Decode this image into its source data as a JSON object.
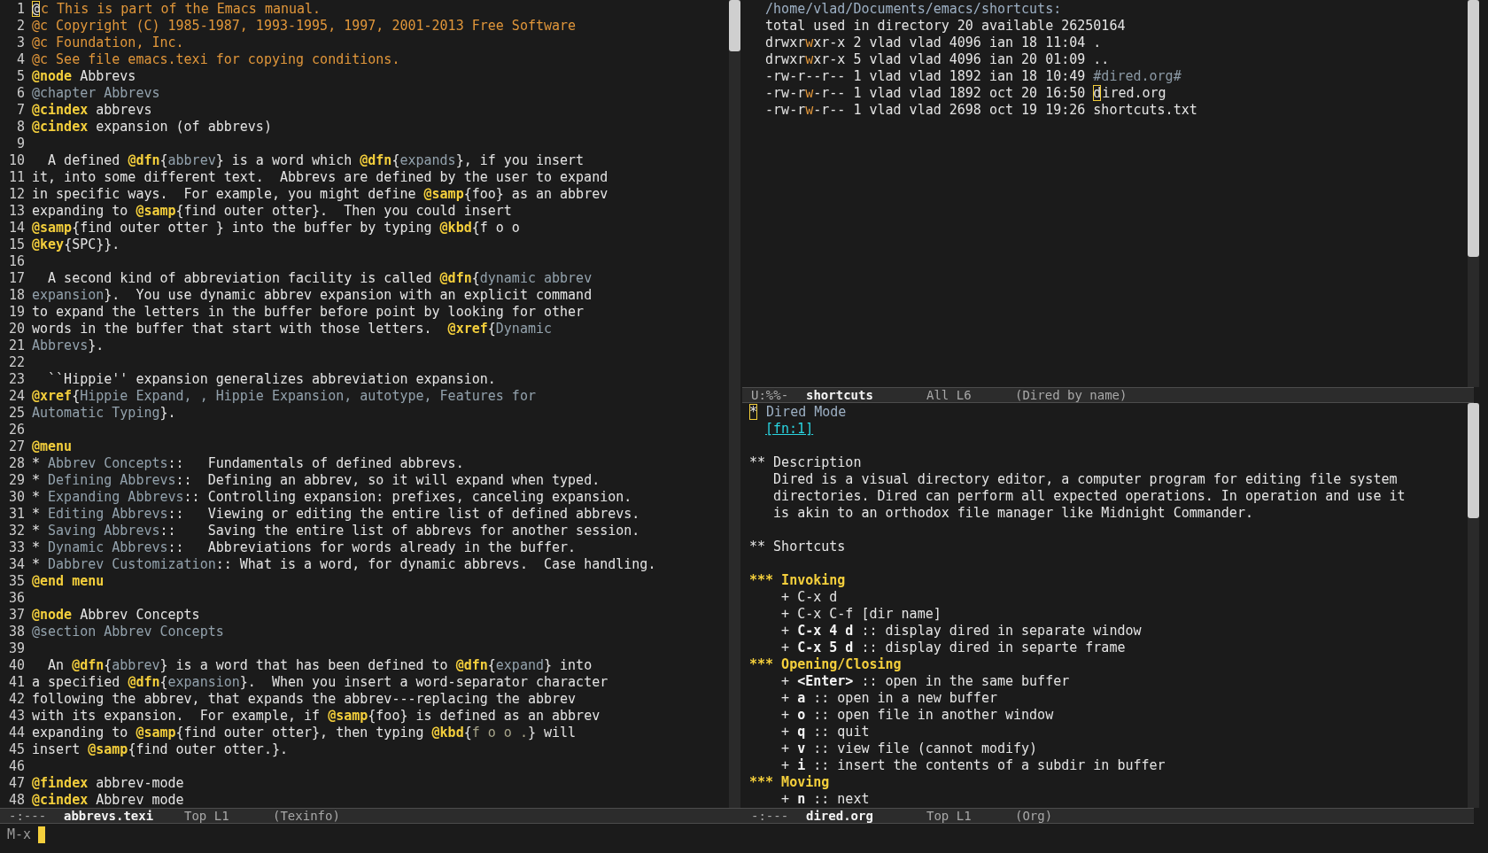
{
  "left_window": {
    "lines": [
      {
        "number": "1",
        "segments": [
          {
            "kind": "cursor",
            "text": "@"
          },
          {
            "kind": "comment",
            "text": "c This is part of the Emacs manual."
          }
        ]
      },
      {
        "number": "2",
        "segments": [
          {
            "kind": "comment",
            "text": "@c Copyright (C) 1985-1987, 1993-1995, 1997, 2001-2013 Free Software"
          }
        ]
      },
      {
        "number": "3",
        "segments": [
          {
            "kind": "comment",
            "text": "@c Foundation, Inc."
          }
        ]
      },
      {
        "number": "4",
        "segments": [
          {
            "kind": "comment",
            "text": "@c See file emacs.texi for copying conditions."
          }
        ]
      },
      {
        "number": "5",
        "segments": [
          {
            "kind": "keyword",
            "text": "@node"
          },
          {
            "kind": "plain",
            "text": " Abbrevs"
          }
        ]
      },
      {
        "number": "6",
        "segments": [
          {
            "kind": "arg",
            "text": "@chapter Abbrevs"
          }
        ]
      },
      {
        "number": "7",
        "segments": [
          {
            "kind": "keyword",
            "text": "@cindex"
          },
          {
            "kind": "plain",
            "text": " abbrevs"
          }
        ]
      },
      {
        "number": "8",
        "segments": [
          {
            "kind": "keyword",
            "text": "@cindex"
          },
          {
            "kind": "plain",
            "text": " expansion (of abbrevs)"
          }
        ]
      },
      {
        "number": "9"
      },
      {
        "number": "10",
        "segments": [
          {
            "kind": "plain",
            "text": "  A defined "
          },
          {
            "kind": "keyword",
            "text": "@dfn"
          },
          {
            "kind": "plain",
            "text": "{"
          },
          {
            "kind": "arg",
            "text": "abbrev"
          },
          {
            "kind": "plain",
            "text": "} is a word which "
          },
          {
            "kind": "keyword",
            "text": "@dfn"
          },
          {
            "kind": "plain",
            "text": "{"
          },
          {
            "kind": "arg",
            "text": "expands"
          },
          {
            "kind": "plain",
            "text": "}, if you insert"
          }
        ]
      },
      {
        "number": "11",
        "segments": [
          {
            "kind": "plain",
            "text": "it, into some different text.  Abbrevs are defined by the user to expand"
          }
        ]
      },
      {
        "number": "12",
        "segments": [
          {
            "kind": "plain",
            "text": "in specific ways.  For example, you might define "
          },
          {
            "kind": "keyword",
            "text": "@samp"
          },
          {
            "kind": "plain",
            "text": "{foo} as an abbrev"
          }
        ]
      },
      {
        "number": "13",
        "segments": [
          {
            "kind": "plain",
            "text": "expanding to "
          },
          {
            "kind": "keyword",
            "text": "@samp"
          },
          {
            "kind": "plain",
            "text": "{find outer otter}.  Then you could insert"
          }
        ]
      },
      {
        "number": "14",
        "segments": [
          {
            "kind": "keyword",
            "text": "@samp"
          },
          {
            "kind": "plain",
            "text": "{find outer otter } into the buffer by typing "
          },
          {
            "kind": "keyword",
            "text": "@kbd"
          },
          {
            "kind": "plain",
            "text": "{f o o"
          }
        ]
      },
      {
        "number": "15",
        "segments": [
          {
            "kind": "keyword",
            "text": "@key"
          },
          {
            "kind": "plain",
            "text": "{SPC}}."
          }
        ]
      },
      {
        "number": "16"
      },
      {
        "number": "17",
        "segments": [
          {
            "kind": "plain",
            "text": "  A second kind of abbreviation facility is called "
          },
          {
            "kind": "keyword",
            "text": "@dfn"
          },
          {
            "kind": "plain",
            "text": "{"
          },
          {
            "kind": "arg",
            "text": "dynamic abbrev"
          }
        ]
      },
      {
        "number": "18",
        "segments": [
          {
            "kind": "arg",
            "text": "expansion"
          },
          {
            "kind": "plain",
            "text": "}.  You use dynamic abbrev expansion with an explicit command"
          }
        ]
      },
      {
        "number": "19",
        "segments": [
          {
            "kind": "plain",
            "text": "to expand the letters in the buffer before point by looking for other"
          }
        ]
      },
      {
        "number": "20",
        "segments": [
          {
            "kind": "plain",
            "text": "words in the buffer that start with those letters.  "
          },
          {
            "kind": "keyword",
            "text": "@xref"
          },
          {
            "kind": "plain",
            "text": "{"
          },
          {
            "kind": "arg",
            "text": "Dynamic"
          }
        ]
      },
      {
        "number": "21",
        "segments": [
          {
            "kind": "arg",
            "text": "Abbrevs"
          },
          {
            "kind": "plain",
            "text": "}."
          }
        ]
      },
      {
        "number": "22"
      },
      {
        "number": "23",
        "segments": [
          {
            "kind": "plain",
            "text": "  ``Hippie'' expansion generalizes abbreviation expansion."
          }
        ]
      },
      {
        "number": "24",
        "segments": [
          {
            "kind": "keyword",
            "text": "@xref"
          },
          {
            "kind": "plain",
            "text": "{"
          },
          {
            "kind": "arg",
            "text": "Hippie Expand, , Hippie Expansion, autotype, Features for"
          }
        ]
      },
      {
        "number": "25",
        "segments": [
          {
            "kind": "arg",
            "text": "Automatic Typing"
          },
          {
            "kind": "plain",
            "text": "}."
          }
        ]
      },
      {
        "number": "26"
      },
      {
        "number": "27",
        "segments": [
          {
            "kind": "keyword",
            "text": "@menu"
          }
        ]
      },
      {
        "number": "28",
        "segments": [
          {
            "kind": "plain",
            "text": "* "
          },
          {
            "kind": "arg",
            "text": "Abbrev Concepts"
          },
          {
            "kind": "plain",
            "text": "::   Fundamentals of defined abbrevs."
          }
        ]
      },
      {
        "number": "29",
        "segments": [
          {
            "kind": "plain",
            "text": "* "
          },
          {
            "kind": "arg",
            "text": "Defining Abbrevs"
          },
          {
            "kind": "plain",
            "text": "::  Defining an abbrev, so it will expand when typed."
          }
        ]
      },
      {
        "number": "30",
        "segments": [
          {
            "kind": "plain",
            "text": "* "
          },
          {
            "kind": "arg",
            "text": "Expanding Abbrevs"
          },
          {
            "kind": "plain",
            "text": ":: Controlling expansion: prefixes, canceling expansion."
          }
        ]
      },
      {
        "number": "31",
        "segments": [
          {
            "kind": "plain",
            "text": "* "
          },
          {
            "kind": "arg",
            "text": "Editing Abbrevs"
          },
          {
            "kind": "plain",
            "text": "::   Viewing or editing the entire list of defined abbrevs."
          }
        ]
      },
      {
        "number": "32",
        "segments": [
          {
            "kind": "plain",
            "text": "* "
          },
          {
            "kind": "arg",
            "text": "Saving Abbrevs"
          },
          {
            "kind": "plain",
            "text": "::    Saving the entire list of abbrevs for another session."
          }
        ]
      },
      {
        "number": "33",
        "segments": [
          {
            "kind": "plain",
            "text": "* "
          },
          {
            "kind": "arg",
            "text": "Dynamic Abbrevs"
          },
          {
            "kind": "plain",
            "text": "::   Abbreviations for words already in the buffer."
          }
        ]
      },
      {
        "number": "34",
        "segments": [
          {
            "kind": "plain",
            "text": "* "
          },
          {
            "kind": "arg",
            "text": "Dabbrev Customization"
          },
          {
            "kind": "plain",
            "text": ":: What is a word, for dynamic abbrevs.  Case handling."
          }
        ]
      },
      {
        "number": "35",
        "segments": [
          {
            "kind": "keyword",
            "text": "@end menu"
          }
        ]
      },
      {
        "number": "36"
      },
      {
        "number": "37",
        "segments": [
          {
            "kind": "keyword",
            "text": "@node"
          },
          {
            "kind": "plain",
            "text": " Abbrev Concepts"
          }
        ]
      },
      {
        "number": "38",
        "segments": [
          {
            "kind": "arg",
            "text": "@section Abbrev Concepts"
          }
        ]
      },
      {
        "number": "39"
      },
      {
        "number": "40",
        "segments": [
          {
            "kind": "plain",
            "text": "  An "
          },
          {
            "kind": "keyword",
            "text": "@dfn"
          },
          {
            "kind": "plain",
            "text": "{"
          },
          {
            "kind": "arg",
            "text": "abbrev"
          },
          {
            "kind": "plain",
            "text": "} is a word that has been defined to "
          },
          {
            "kind": "keyword",
            "text": "@dfn"
          },
          {
            "kind": "plain",
            "text": "{"
          },
          {
            "kind": "arg",
            "text": "expand"
          },
          {
            "kind": "plain",
            "text": "} into"
          }
        ]
      },
      {
        "number": "41",
        "segments": [
          {
            "kind": "plain",
            "text": "a specified "
          },
          {
            "kind": "keyword",
            "text": "@dfn"
          },
          {
            "kind": "plain",
            "text": "{"
          },
          {
            "kind": "arg",
            "text": "expansion"
          },
          {
            "kind": "plain",
            "text": "}.  When you insert a word-separator character"
          }
        ]
      },
      {
        "number": "42",
        "segments": [
          {
            "kind": "plain",
            "text": "following the abbrev, that expands the abbrev---replacing the abbrev"
          }
        ]
      },
      {
        "number": "43",
        "segments": [
          {
            "kind": "plain",
            "text": "with its expansion.  For example, if "
          },
          {
            "kind": "keyword",
            "text": "@samp"
          },
          {
            "kind": "plain",
            "text": "{foo} is defined as an abbrev"
          }
        ]
      },
      {
        "number": "44",
        "segments": [
          {
            "kind": "plain",
            "text": "expanding to "
          },
          {
            "kind": "keyword",
            "text": "@samp"
          },
          {
            "kind": "plain",
            "text": "{find outer otter}, then typing "
          },
          {
            "kind": "keyword",
            "text": "@kbd"
          },
          {
            "kind": "plain",
            "text": "{"
          },
          {
            "kind": "key_arg",
            "text": "f o o ."
          },
          {
            "kind": "plain",
            "text": "} will"
          }
        ]
      },
      {
        "number": "45",
        "segments": [
          {
            "kind": "plain",
            "text": "insert "
          },
          {
            "kind": "keyword",
            "text": "@samp"
          },
          {
            "kind": "plain",
            "text": "{find outer otter.}."
          }
        ]
      },
      {
        "number": "46"
      },
      {
        "number": "47",
        "segments": [
          {
            "kind": "keyword",
            "text": "@findex"
          },
          {
            "kind": "plain",
            "text": " abbrev-mode"
          }
        ]
      },
      {
        "number": "48",
        "segments": [
          {
            "kind": "keyword",
            "text": "@cindex"
          },
          {
            "kind": "plain",
            "text": " Abbrev mode"
          }
        ]
      }
    ],
    "mode_line": {
      "flags": "-:---",
      "buffer": "abbrevs.texi",
      "position": "Top L1",
      "mode": "(Texinfo)"
    }
  },
  "right_top_window": {
    "lines": [
      {
        "segments": [
          {
            "kind": "path",
            "text": "  /home/vlad/Documents/emacs/shortcuts:"
          }
        ]
      },
      {
        "segments": [
          {
            "kind": "plain",
            "text": "  total used in directory 20 available 26250164"
          }
        ]
      },
      {
        "segments": [
          {
            "kind": "plain",
            "text": "  drwxr"
          },
          {
            "kind": "perm_w",
            "text": "w"
          },
          {
            "kind": "plain",
            "text": "xr-x 2 vlad vlad 4096 ian 18 11:04 ."
          }
        ]
      },
      {
        "segments": [
          {
            "kind": "plain",
            "text": "  drwxr"
          },
          {
            "kind": "perm_w",
            "text": "w"
          },
          {
            "kind": "plain",
            "text": "xr-x 5 vlad vlad 4096 ian 20 01:09 .."
          }
        ]
      },
      {
        "segments": [
          {
            "kind": "plain",
            "text": "  -rw-r--r-- 1 vlad vlad 1892 ian 18 10:49 "
          },
          {
            "kind": "dim",
            "text": "#dired.org#"
          }
        ]
      },
      {
        "segments": [
          {
            "kind": "plain",
            "text": "  -rw-r"
          },
          {
            "kind": "perm_w",
            "text": "w"
          },
          {
            "kind": "plain",
            "text": "-r-- 1 vlad vlad 1892 oct 20 16:50 "
          },
          {
            "kind": "cursor",
            "text": "d"
          },
          {
            "kind": "plain",
            "text": "ired.org"
          }
        ]
      },
      {
        "segments": [
          {
            "kind": "plain",
            "text": "  -rw-r"
          },
          {
            "kind": "perm_w",
            "text": "w"
          },
          {
            "kind": "plain",
            "text": "-r-- 1 vlad vlad 2698 oct 19 19:26 shortcuts.txt"
          }
        ]
      }
    ],
    "mode_line": {
      "flags": "U:%%-",
      "buffer": "shortcuts",
      "position": "All L6",
      "mode": "(Dired by name)"
    }
  },
  "right_bottom_window": {
    "lines": [
      {
        "segments": [
          {
            "kind": "cursor",
            "text": "*"
          },
          {
            "kind": "path",
            "text": " Dired Mode"
          }
        ]
      },
      {
        "kind": "footnote",
        "segments": [
          {
            "kind": "link",
            "text": "[fn:1]"
          }
        ]
      },
      {
        "kind": "blank"
      },
      {
        "segments": [
          {
            "kind": "plain",
            "text": "** Description"
          }
        ]
      },
      {
        "segments": [
          {
            "kind": "plain",
            "text": "   Dired is a visual directory editor, a computer program for editing file system"
          }
        ]
      },
      {
        "segments": [
          {
            "kind": "plain",
            "text": "   directories. Dired can perform all expected operations. In operation and use it"
          }
        ]
      },
      {
        "segments": [
          {
            "kind": "plain",
            "text": "   is akin to an orthodox file manager like Midnight Commander."
          }
        ]
      },
      {
        "kind": "blank"
      },
      {
        "segments": [
          {
            "kind": "plain",
            "text": "** Shortcuts"
          }
        ]
      },
      {
        "kind": "blank"
      },
      {
        "segments": [
          {
            "kind": "heading",
            "text": "*** Invoking"
          }
        ]
      },
      {
        "segments": [
          {
            "kind": "plain",
            "text": "    + C-x d"
          }
        ]
      },
      {
        "segments": [
          {
            "kind": "plain",
            "text": "    + C-x C-f [dir name]"
          }
        ]
      },
      {
        "segments": [
          {
            "kind": "plain",
            "text": "    + "
          },
          {
            "kind": "bold",
            "text": "C-x 4 d"
          },
          {
            "kind": "plain",
            "text": " :: display dired in separate window"
          }
        ]
      },
      {
        "segments": [
          {
            "kind": "plain",
            "text": "    + "
          },
          {
            "kind": "bold",
            "text": "C-x 5 d"
          },
          {
            "kind": "plain",
            "text": " :: display dired in separte frame"
          }
        ]
      },
      {
        "segments": [
          {
            "kind": "heading",
            "text": "*** Opening/Closing"
          }
        ]
      },
      {
        "segments": [
          {
            "kind": "plain",
            "text": "    + "
          },
          {
            "kind": "bold",
            "text": "<Enter>"
          },
          {
            "kind": "plain",
            "text": " :: open in the same buffer"
          }
        ]
      },
      {
        "segments": [
          {
            "kind": "plain",
            "text": "    + "
          },
          {
            "kind": "bold",
            "text": "a"
          },
          {
            "kind": "plain",
            "text": " :: open in a new buffer"
          }
        ]
      },
      {
        "segments": [
          {
            "kind": "plain",
            "text": "    + "
          },
          {
            "kind": "bold",
            "text": "o"
          },
          {
            "kind": "plain",
            "text": " :: open file in another window"
          }
        ]
      },
      {
        "segments": [
          {
            "kind": "plain",
            "text": "    + "
          },
          {
            "kind": "bold",
            "text": "q"
          },
          {
            "kind": "plain",
            "text": " :: quit"
          }
        ]
      },
      {
        "segments": [
          {
            "kind": "plain",
            "text": "    + "
          },
          {
            "kind": "bold",
            "text": "v"
          },
          {
            "kind": "plain",
            "text": " :: view file (cannot modify)"
          }
        ]
      },
      {
        "segments": [
          {
            "kind": "plain",
            "text": "    + "
          },
          {
            "kind": "bold",
            "text": "i"
          },
          {
            "kind": "plain",
            "text": " :: insert the contents of a subdir in buffer"
          }
        ]
      },
      {
        "segments": [
          {
            "kind": "heading",
            "text": "*** Moving"
          }
        ]
      },
      {
        "segments": [
          {
            "kind": "plain",
            "text": "    + "
          },
          {
            "kind": "bold",
            "text": "n"
          },
          {
            "kind": "plain",
            "text": " :: next"
          }
        ]
      }
    ],
    "mode_line": {
      "flags": "-:---",
      "buffer": "dired.org",
      "position": "Top L1",
      "mode": "(Org)"
    }
  },
  "minibuffer": {
    "prompt": "M-x"
  }
}
